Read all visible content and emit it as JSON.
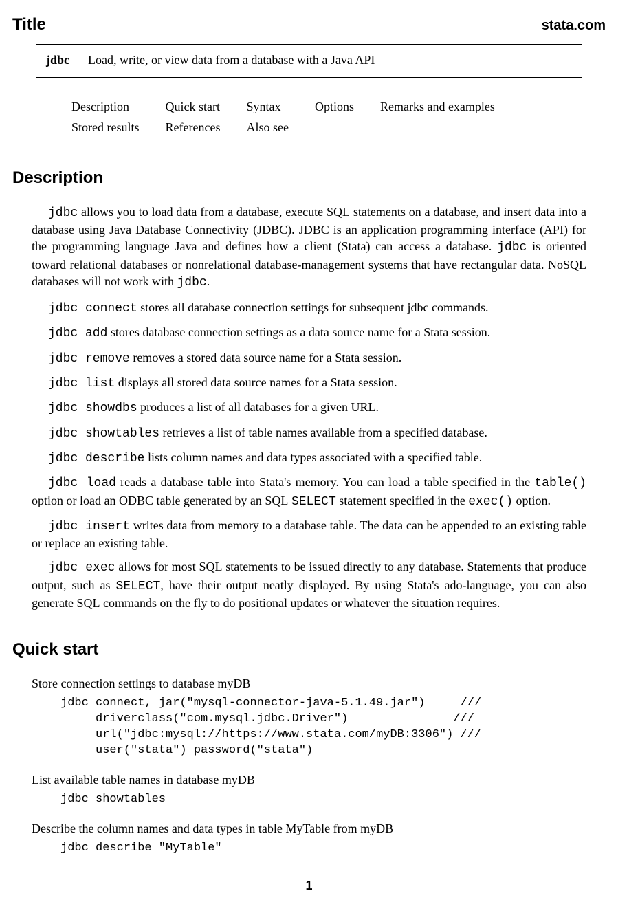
{
  "header": {
    "title": "Title",
    "brand": "stata.com"
  },
  "title_box": {
    "cmd": "jdbc",
    "dash": "—",
    "desc": "Load, write, or view data from a database with a Java API"
  },
  "nav": {
    "row1": [
      "Description",
      "Quick start",
      "Syntax",
      "Options",
      "Remarks and examples"
    ],
    "row2": [
      "Stored results",
      "References",
      "Also see"
    ]
  },
  "description": {
    "heading": "Description",
    "intro": "jdbc allows you to load data from a database, execute SQL statements on a database, and insert data into a database using Java Database Connectivity (JDBC). JDBC is an application programming interface (API) for the programming language Java and defines how a client (Stata) can access a database. jdbc is oriented toward relational databases or nonrelational database-management systems that have rectangular data. NoSQL databases will not work with jdbc.",
    "items": [
      {
        "cmd": "jdbc connect",
        "text": " stores all database connection settings for subsequent jdbc commands."
      },
      {
        "cmd": "jdbc add",
        "text": " stores database connection settings as a data source name for a Stata session."
      },
      {
        "cmd": "jdbc remove",
        "text": " removes a stored data source name for a Stata session."
      },
      {
        "cmd": "jdbc list",
        "text": " displays all stored data source names for a Stata session."
      },
      {
        "cmd": "jdbc showdbs",
        "text": " produces a list of all databases for a given URL."
      },
      {
        "cmd": "jdbc showtables",
        "text": " retrieves a list of table names available from a specified database."
      },
      {
        "cmd": "jdbc describe",
        "text": " lists column names and data types associated with a specified table."
      }
    ],
    "load": {
      "cmd": "jdbc load",
      "text": " reads a database table into Stata's memory. You can load a table specified in the table() option or load an ODBC table generated by an SQL SELECT statement specified in the exec() option."
    },
    "insert": {
      "cmd": "jdbc insert",
      "text": " writes data from memory to a database table. The data can be appended to an existing table or replace an existing table."
    },
    "exec": {
      "cmd": "jdbc exec",
      "text": " allows for most SQL statements to be issued directly to any database. Statements that produce output, such as SELECT, have their output neatly displayed. By using Stata's ado-language, you can also generate SQL commands on the fly to do positional updates or whatever the situation requires."
    }
  },
  "quickstart": {
    "heading": "Quick start",
    "ex1_label": "Store connection settings to database myDB",
    "ex1_code": "jdbc connect, jar(\"mysql-connector-java-5.1.49.jar\")     ///\n     driverclass(\"com.mysql.jdbc.Driver\")               ///\n     url(\"jdbc:mysql://https://www.stata.com/myDB:3306\") ///\n     user(\"stata\") password(\"stata\")",
    "ex2_label": "List available table names in database myDB",
    "ex2_code": "jdbc showtables",
    "ex3_label": "Describe the column names and data types in table MyTable from myDB",
    "ex3_code": "jdbc describe \"MyTable\""
  },
  "page_number": "1"
}
